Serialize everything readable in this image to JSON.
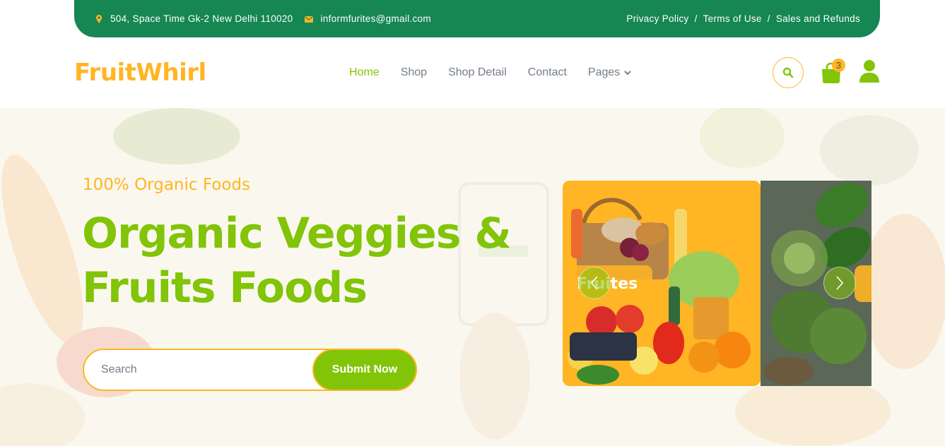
{
  "topbar": {
    "address": "504, Space Time Gk-2 New Delhi 110020",
    "email": "informfurites@gmail.com",
    "links": [
      "Privacy Policy",
      "Terms of Use",
      "Sales and Refunds"
    ],
    "separator": "/"
  },
  "navbar": {
    "brand": "FruitWhirl",
    "menu": [
      "Home",
      "Shop",
      "Shop Detail",
      "Contact",
      "Pages"
    ],
    "active_item": "Home",
    "cart_count": "3",
    "icons": [
      "search-icon",
      "shopping-bag-icon",
      "user-icon"
    ]
  },
  "hero": {
    "eyebrow": "100% Organic Foods",
    "headline_line1": "Organic Veggies &",
    "headline_line2": "Fruits Foods",
    "search_placeholder": "Search",
    "submit_label": "Submit Now"
  },
  "carousel": {
    "slide_label": "Fruites"
  },
  "colors": {
    "topbar": "#168653",
    "brand": "#ffb524",
    "accent_green": "#81c408",
    "text_muted": "#747d88"
  }
}
